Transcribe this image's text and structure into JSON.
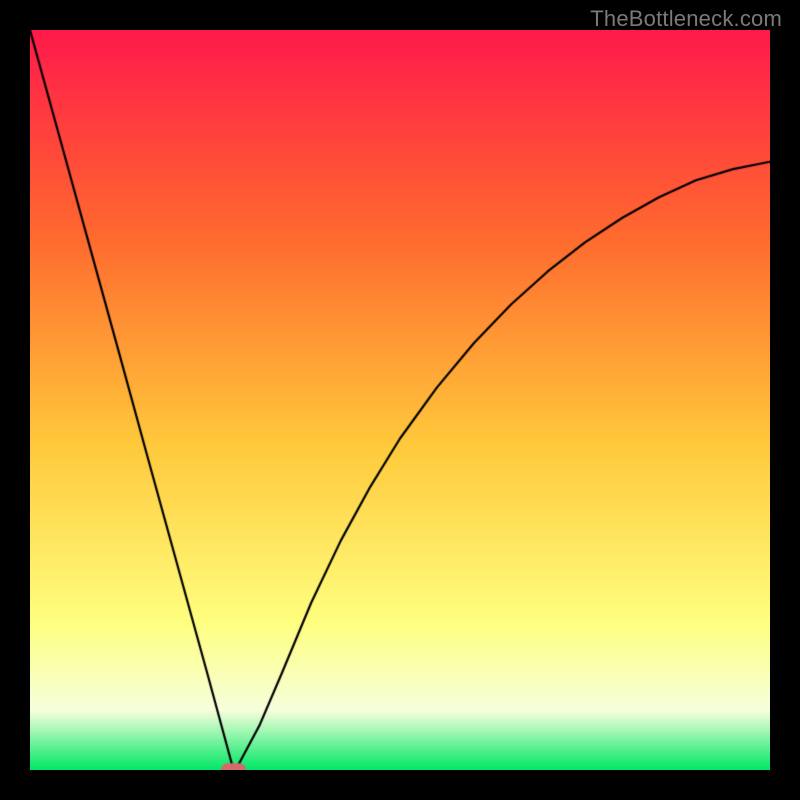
{
  "watermark": "TheBottleneck.com",
  "colors": {
    "frame": "#000000",
    "grad_top": "#ff1a4b",
    "grad_upper_mid": "#ff6a2f",
    "grad_mid": "#ffc93b",
    "grad_lower_mid": "#ffff80",
    "grad_low": "#f6ffdc",
    "grad_bottom": "#00e865",
    "curve": "#000000",
    "marker_fill": "#d46a6a",
    "marker_stroke": "#d46a6a"
  },
  "chart_data": {
    "type": "line",
    "title": "",
    "xlabel": "",
    "ylabel": "",
    "xlim": [
      0,
      1
    ],
    "ylim": [
      0,
      1
    ],
    "tick_labels_x": [],
    "tick_labels_y": [],
    "series": [
      {
        "name": "bottleneck-curve",
        "note": "V-shaped curve: steep linear descent from top-left to a minimum near x≈0.28, then decelerating rise toward right edge reaching y≈0.82 at x=1. y in [0,1], 1=top.",
        "x": [
          0.0,
          0.04,
          0.08,
          0.12,
          0.16,
          0.2,
          0.24,
          0.275,
          0.28,
          0.31,
          0.34,
          0.38,
          0.42,
          0.46,
          0.5,
          0.55,
          0.6,
          0.65,
          0.7,
          0.75,
          0.8,
          0.85,
          0.9,
          0.95,
          1.0
        ],
        "y": [
          1.0,
          0.855,
          0.71,
          0.565,
          0.419,
          0.274,
          0.129,
          0.0,
          0.004,
          0.06,
          0.13,
          0.226,
          0.31,
          0.383,
          0.448,
          0.517,
          0.577,
          0.629,
          0.674,
          0.713,
          0.746,
          0.774,
          0.797,
          0.812,
          0.822
        ]
      }
    ],
    "marker": {
      "note": "Rounded pill marker at curve minimum, sitting on bottom edge of plot.",
      "x": 0.275,
      "y": 0.0,
      "width_frac": 0.034,
      "height_frac": 0.018
    },
    "gradient_stops": [
      {
        "pos": 0.0,
        "color_key": "grad_top"
      },
      {
        "pos": 0.28,
        "color_key": "grad_upper_mid"
      },
      {
        "pos": 0.56,
        "color_key": "grad_mid"
      },
      {
        "pos": 0.8,
        "color_key": "grad_lower_mid"
      },
      {
        "pos": 0.92,
        "color_key": "grad_low"
      },
      {
        "pos": 1.0,
        "color_key": "grad_bottom"
      }
    ]
  }
}
